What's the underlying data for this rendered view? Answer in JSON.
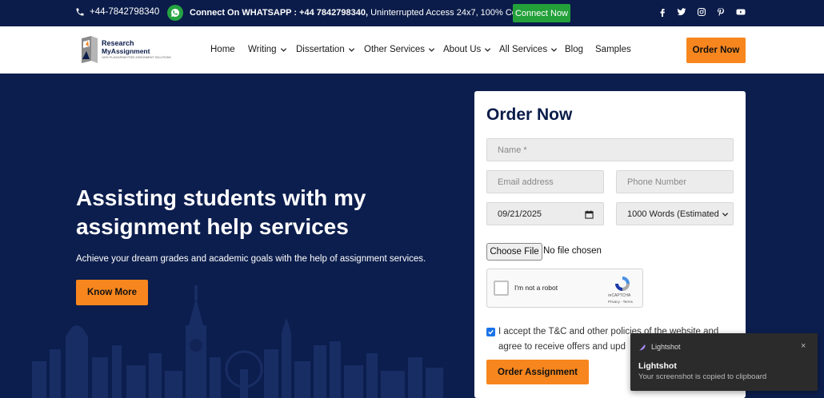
{
  "topbar": {
    "phone": "+44-7842798340",
    "whatsapp_label": "Connect On WHATSAPP : +44 7842798340,",
    "whatsapp_rest": " Uninterrupted Access 24x7, 100% Confidential.",
    "connect_button": "Connect Now",
    "social_icons": [
      "facebook-icon",
      "twitter-icon",
      "instagram-icon",
      "pinterest-icon",
      "youtube-icon"
    ]
  },
  "logo": {
    "line1": "Research",
    "line2": "MyAssignment",
    "tagline": "100% PLAGIARISM FREE ASSIGNMENT SOLUTIONS"
  },
  "nav": {
    "items": [
      {
        "label": "Home",
        "dropdown": false
      },
      {
        "label": "Writing",
        "dropdown": true
      },
      {
        "label": "Dissertation",
        "dropdown": true
      },
      {
        "label": "Other Services",
        "dropdown": true
      },
      {
        "label": "About Us",
        "dropdown": true
      },
      {
        "label": "All Services",
        "dropdown": true
      },
      {
        "label": "Blog",
        "dropdown": false
      },
      {
        "label": "Samples",
        "dropdown": false
      }
    ],
    "order_button": "Order Now"
  },
  "hero": {
    "title_line1": "Assisting students with my",
    "title_line2": "assignment help services",
    "subtitle": "Achieve your dream grades and academic goals with the help of assignment services.",
    "button": "Know More"
  },
  "form": {
    "title": "Order Now",
    "name_placeholder": "Name *",
    "email_placeholder": "Email address",
    "phone_placeholder": "Phone Number",
    "date_value": "09/21/2025",
    "words_value": "1000 Words (Estimated",
    "choose_file": "Choose File",
    "no_file": "No file chosen",
    "recaptcha_label": "I'm not a robot",
    "recaptcha_brand": "reCAPTCHA",
    "recaptcha_links": "Privacy - Terms",
    "accept_text": "I accept the T&C and other policies of the website and agree to receive offers and upd",
    "accept_checked": true,
    "submit": "Order Assignment"
  },
  "toast": {
    "app": "Lightshot",
    "title": "Lightshot",
    "message": "Your screenshot is copied to clipboard",
    "close": "×"
  },
  "colors": {
    "navy": "#0c1e4e",
    "orange": "#f7861e",
    "green": "#23a03a"
  }
}
